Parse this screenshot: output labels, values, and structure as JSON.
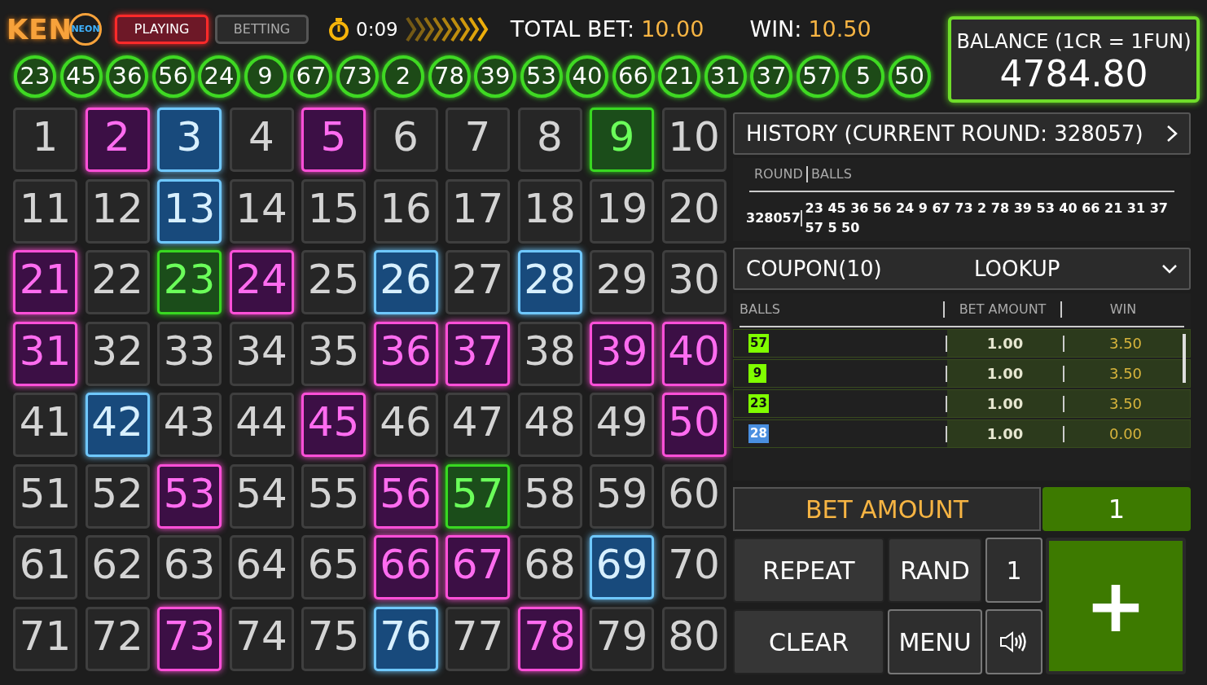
{
  "logo": {
    "word": "KEN",
    "badge": "NEON"
  },
  "mode_tabs": [
    {
      "label": "PLAYING",
      "selected": true
    },
    {
      "label": "BETTING",
      "selected": false
    }
  ],
  "timer": "0:09",
  "total_bet": {
    "label": "TOTAL BET:",
    "value": "10.00"
  },
  "win": {
    "label": "WIN:",
    "value": "10.50"
  },
  "balance": {
    "label": "BALANCE (1CR = 1FUN)",
    "value": "4784.80"
  },
  "drawn_balls": [
    "23",
    "45",
    "36",
    "56",
    "24",
    "9",
    "67",
    "73",
    "2",
    "78",
    "39",
    "53",
    "40",
    "66",
    "21",
    "31",
    "37",
    "57",
    "5",
    "50"
  ],
  "board": [
    {
      "number": "1",
      "kind": "plain"
    },
    {
      "number": "2",
      "kind": "drawn"
    },
    {
      "number": "3",
      "kind": "picked"
    },
    {
      "number": "4",
      "kind": "plain"
    },
    {
      "number": "5",
      "kind": "drawn"
    },
    {
      "number": "6",
      "kind": "plain"
    },
    {
      "number": "7",
      "kind": "plain"
    },
    {
      "number": "8",
      "kind": "plain"
    },
    {
      "number": "9",
      "kind": "hit"
    },
    {
      "number": "10",
      "kind": "plain"
    },
    {
      "number": "11",
      "kind": "plain"
    },
    {
      "number": "12",
      "kind": "plain"
    },
    {
      "number": "13",
      "kind": "picked"
    },
    {
      "number": "14",
      "kind": "plain"
    },
    {
      "number": "15",
      "kind": "plain"
    },
    {
      "number": "16",
      "kind": "plain"
    },
    {
      "number": "17",
      "kind": "plain"
    },
    {
      "number": "18",
      "kind": "plain"
    },
    {
      "number": "19",
      "kind": "plain"
    },
    {
      "number": "20",
      "kind": "plain"
    },
    {
      "number": "21",
      "kind": "drawn"
    },
    {
      "number": "22",
      "kind": "plain"
    },
    {
      "number": "23",
      "kind": "hit"
    },
    {
      "number": "24",
      "kind": "drawn"
    },
    {
      "number": "25",
      "kind": "plain"
    },
    {
      "number": "26",
      "kind": "picked"
    },
    {
      "number": "27",
      "kind": "plain"
    },
    {
      "number": "28",
      "kind": "picked"
    },
    {
      "number": "29",
      "kind": "plain"
    },
    {
      "number": "30",
      "kind": "plain"
    },
    {
      "number": "31",
      "kind": "drawn"
    },
    {
      "number": "32",
      "kind": "plain"
    },
    {
      "number": "33",
      "kind": "plain"
    },
    {
      "number": "34",
      "kind": "plain"
    },
    {
      "number": "35",
      "kind": "plain"
    },
    {
      "number": "36",
      "kind": "drawn"
    },
    {
      "number": "37",
      "kind": "drawn"
    },
    {
      "number": "38",
      "kind": "plain"
    },
    {
      "number": "39",
      "kind": "drawn"
    },
    {
      "number": "40",
      "kind": "drawn"
    },
    {
      "number": "41",
      "kind": "plain"
    },
    {
      "number": "42",
      "kind": "picked"
    },
    {
      "number": "43",
      "kind": "plain"
    },
    {
      "number": "44",
      "kind": "plain"
    },
    {
      "number": "45",
      "kind": "drawn"
    },
    {
      "number": "46",
      "kind": "plain"
    },
    {
      "number": "47",
      "kind": "plain"
    },
    {
      "number": "48",
      "kind": "plain"
    },
    {
      "number": "49",
      "kind": "plain"
    },
    {
      "number": "50",
      "kind": "drawn"
    },
    {
      "number": "51",
      "kind": "plain"
    },
    {
      "number": "52",
      "kind": "plain"
    },
    {
      "number": "53",
      "kind": "drawn"
    },
    {
      "number": "54",
      "kind": "plain"
    },
    {
      "number": "55",
      "kind": "plain"
    },
    {
      "number": "56",
      "kind": "drawn"
    },
    {
      "number": "57",
      "kind": "hit"
    },
    {
      "number": "58",
      "kind": "plain"
    },
    {
      "number": "59",
      "kind": "plain"
    },
    {
      "number": "60",
      "kind": "plain"
    },
    {
      "number": "61",
      "kind": "plain"
    },
    {
      "number": "62",
      "kind": "plain"
    },
    {
      "number": "63",
      "kind": "plain"
    },
    {
      "number": "64",
      "kind": "plain"
    },
    {
      "number": "65",
      "kind": "plain"
    },
    {
      "number": "66",
      "kind": "drawn"
    },
    {
      "number": "67",
      "kind": "drawn"
    },
    {
      "number": "68",
      "kind": "plain"
    },
    {
      "number": "69",
      "kind": "picked"
    },
    {
      "number": "70",
      "kind": "plain"
    },
    {
      "number": "71",
      "kind": "plain"
    },
    {
      "number": "72",
      "kind": "plain"
    },
    {
      "number": "73",
      "kind": "drawn"
    },
    {
      "number": "74",
      "kind": "plain"
    },
    {
      "number": "75",
      "kind": "plain"
    },
    {
      "number": "76",
      "kind": "picked"
    },
    {
      "number": "77",
      "kind": "plain"
    },
    {
      "number": "78",
      "kind": "drawn"
    },
    {
      "number": "79",
      "kind": "plain"
    },
    {
      "number": "80",
      "kind": "plain"
    }
  ],
  "history": {
    "title": "HISTORY (CURRENT ROUND: 328057)",
    "columns": [
      "ROUND",
      "BALLS"
    ],
    "rows": [
      {
        "round": "328057",
        "balls": "23 45 36 56 24 9 67 73 2 78 39 53 40 66 21 31 37 57 5 50"
      }
    ]
  },
  "coupon": {
    "title": "COUPON(10)",
    "action": "LOOKUP",
    "columns": [
      "BALLS",
      "BET AMOUNT",
      "WIN"
    ],
    "rows": [
      {
        "ball": "57",
        "color": "#80ff00",
        "bet": "1.00",
        "win": "3.50"
      },
      {
        "ball": "9",
        "color": "#80ff00",
        "bet": "1.00",
        "win": "3.50"
      },
      {
        "ball": "23",
        "color": "#80ff00",
        "bet": "1.00",
        "win": "3.50"
      },
      {
        "ball": "28",
        "color": "#4a8fe0",
        "bet": "1.00",
        "win": "0.00"
      }
    ]
  },
  "bet_amount": {
    "label": "BET AMOUNT",
    "value": "1"
  },
  "buttons": {
    "repeat": "REPEAT",
    "rand": "RAND",
    "count": "1",
    "clear": "CLEAR",
    "menu": "MENU",
    "plus": "+"
  }
}
